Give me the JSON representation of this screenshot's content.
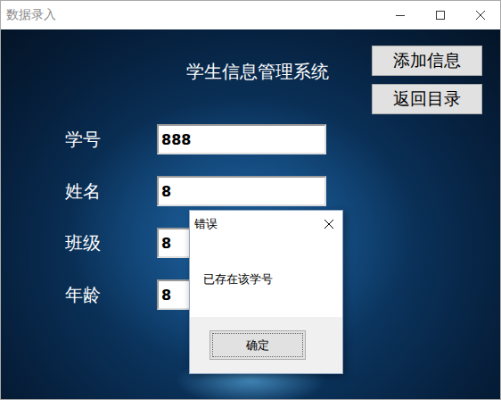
{
  "window": {
    "title": "数据录入"
  },
  "header": {
    "title": "学生信息管理系统"
  },
  "buttons": [
    "添加信息",
    "返回目录"
  ],
  "fields": [
    {
      "label": "学号",
      "value": "888"
    },
    {
      "label": "姓名",
      "value": "8"
    },
    {
      "label": "班级",
      "value": "8"
    },
    {
      "label": "年龄",
      "value": "8"
    }
  ],
  "dialog": {
    "title": "错误",
    "message": "已存在该学号",
    "buttons": [
      "确定"
    ]
  }
}
